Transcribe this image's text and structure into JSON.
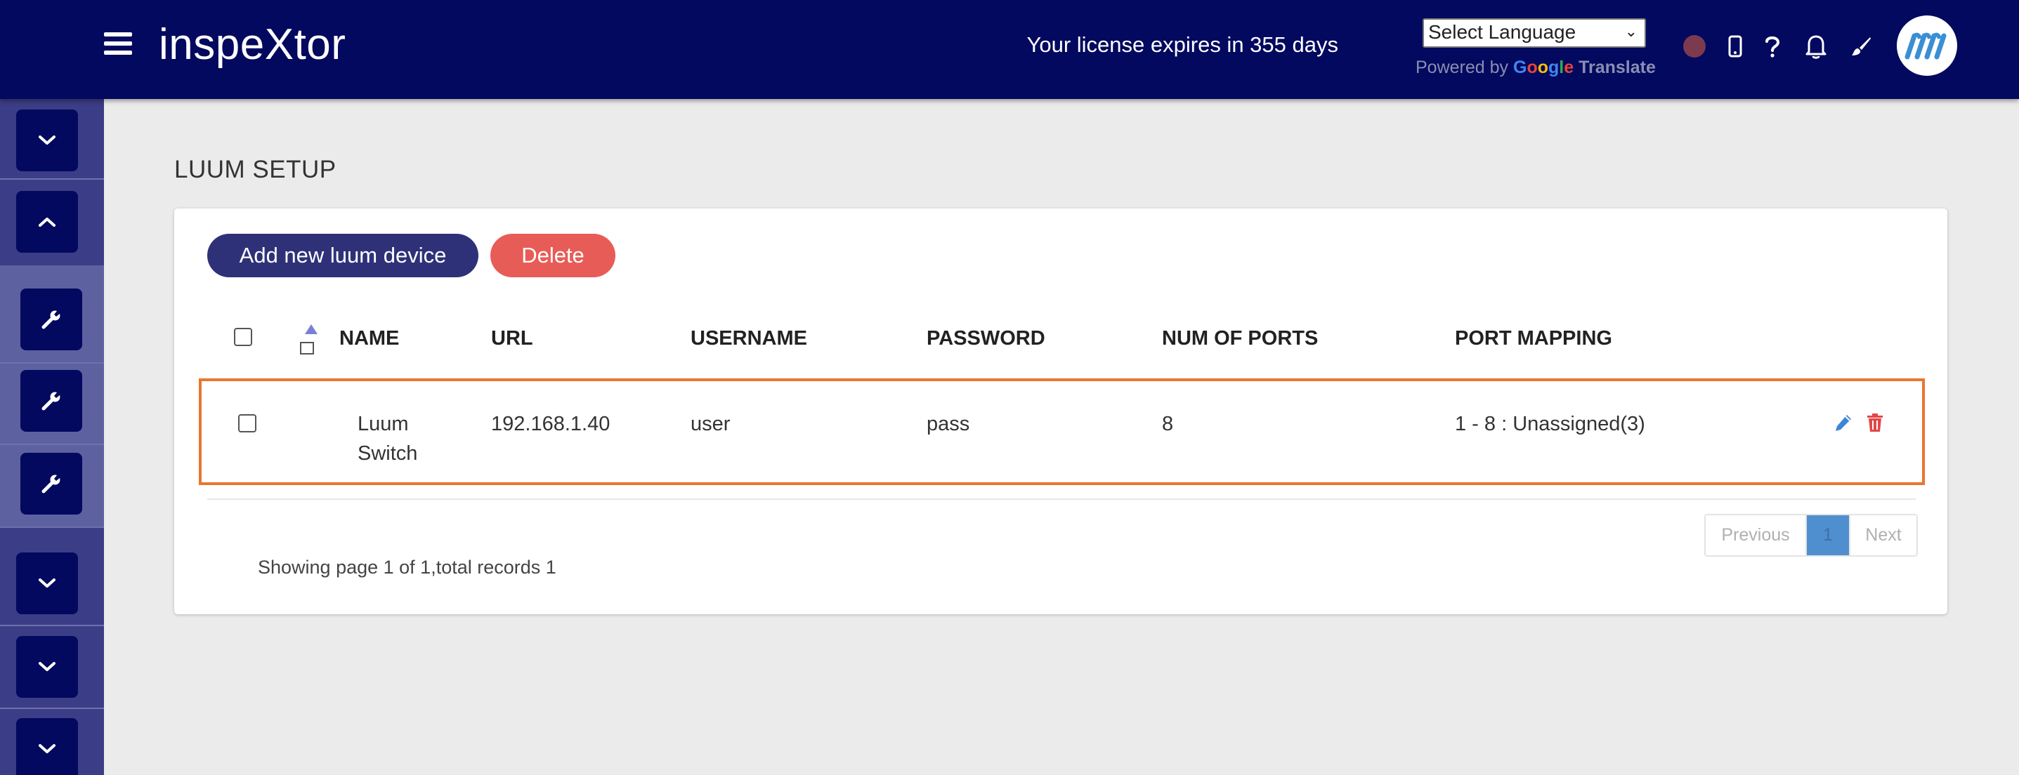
{
  "app": {
    "logo": "inspeXtor",
    "license_text": "Your license expires in 355 days"
  },
  "translate": {
    "select_label": "Select Language",
    "powered_by": "Powered by",
    "google": [
      "G",
      "o",
      "o",
      "g",
      "l",
      "e"
    ],
    "translate_label": "Translate"
  },
  "header_icons": [
    "status-dot-icon",
    "mobile-icon",
    "help-icon",
    "bell-icon",
    "brush-icon",
    "avatar-logo-icon"
  ],
  "sidebar": {
    "items": [
      {
        "icon": "chevron-down-icon"
      },
      {
        "icon": "chevron-up-icon"
      },
      {
        "icon": "wrench-icon"
      },
      {
        "icon": "wrench-icon"
      },
      {
        "icon": "wrench-icon"
      },
      {
        "icon": "chevron-down-icon"
      },
      {
        "icon": "chevron-down-icon"
      },
      {
        "icon": "chevron-down-icon"
      }
    ]
  },
  "page": {
    "title": "LUUM SETUP",
    "add_button": "Add new luum device",
    "delete_button": "Delete"
  },
  "table": {
    "columns": [
      "NAME",
      "URL",
      "USERNAME",
      "PASSWORD",
      "NUM OF PORTS",
      "PORT MAPPING"
    ],
    "rows": [
      {
        "name_line1": "Luum",
        "name_line2": "Switch",
        "url": "192.168.1.40",
        "username": "user",
        "password": "pass",
        "num_ports": "8",
        "port_mapping": "1 - 8 : Unassigned(3)"
      }
    ],
    "row_actions": [
      "edit-icon",
      "trash-icon"
    ]
  },
  "pagination": {
    "summary": "Showing page 1 of 1,total records 1",
    "previous": "Previous",
    "current": "1",
    "next": "Next"
  },
  "colors": {
    "header_bg": "#03095e",
    "sidebar_bg": "#3b3e86",
    "primary_button": "#2f3178",
    "danger_button": "#e85c57",
    "row_highlight": "#e8772e",
    "edit_icon": "#3d86d6",
    "trash_icon": "#e04848",
    "page_active": "#4f8fcf"
  }
}
